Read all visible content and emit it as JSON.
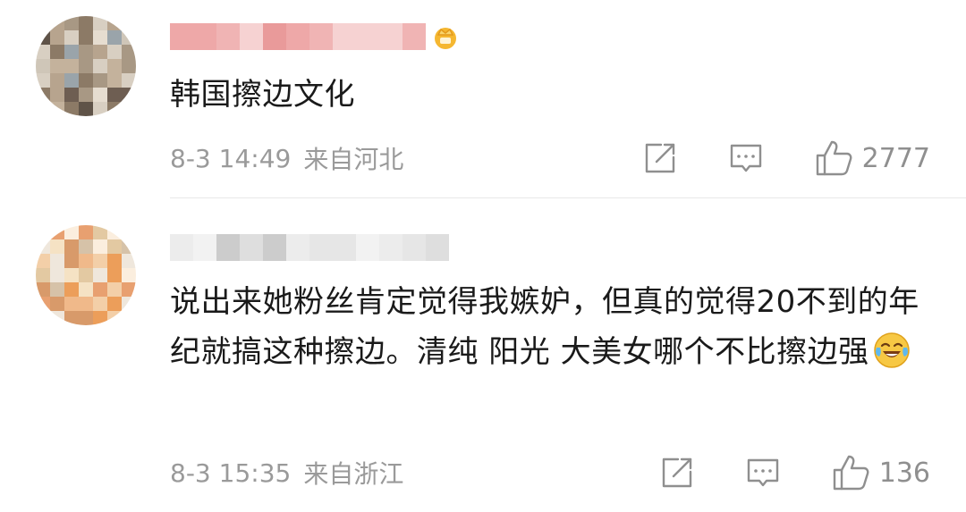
{
  "comments": [
    {
      "text": "韩国擦边文化",
      "time": "8-3 14:49",
      "location": "来自河北",
      "likes": "2777",
      "has_vip_badge": true
    },
    {
      "text": "说出来她粉丝肯定觉得我嫉妒，但真的觉得20不到的年纪就搞这种擦边。清纯 阳光 大美女哪个不比擦边强",
      "time": "8-3 15:35",
      "location": "来自浙江",
      "likes": "136",
      "emoji": "laughing-crying-emoji"
    }
  ],
  "icons": {
    "share": "share-icon",
    "reply": "comment-icon",
    "like": "thumbs-up-icon"
  },
  "colors": {
    "meta_text": "#9a9a9a",
    "icon_stroke": "#8f8f8f",
    "divider": "#e8e8e8"
  }
}
